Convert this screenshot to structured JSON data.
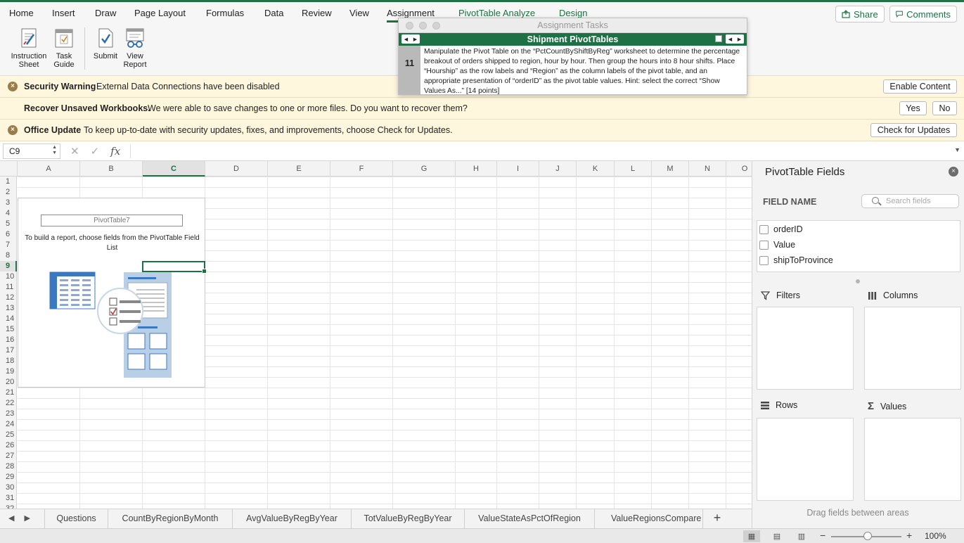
{
  "ribbon_tabs": [
    "Home",
    "Insert",
    "Draw",
    "Page Layout",
    "Formulas",
    "Data",
    "Review",
    "View",
    "Assignment",
    "PivotTable Analyze",
    "Design"
  ],
  "active_tab": "Assignment",
  "share_label": "Share",
  "comments_label": "Comments",
  "ribbon_buttons": {
    "instruction_sheet": "Instruction Sheet",
    "task_guide": "Task Guide",
    "submit": "Submit",
    "view_report": "View Report"
  },
  "security_bar": {
    "title": "Security Warning",
    "message": "External Data Connections have been disabled",
    "button": "Enable Content"
  },
  "recover_bar": {
    "title": "Recover Unsaved Workbooks.",
    "message": "We were able to save changes to one or more files. Do you want to recover them?",
    "yes": "Yes",
    "no": "No"
  },
  "update_bar": {
    "title": "Office Update",
    "message": "To keep up-to-date with security updates, fixes, and improvements, choose Check for Updates.",
    "button": "Check for Updates"
  },
  "formula_bar": {
    "name_box": "C9",
    "fx": "fx",
    "formula": ""
  },
  "columns": [
    "A",
    "B",
    "C",
    "D",
    "E",
    "F",
    "G",
    "H",
    "I",
    "J",
    "K",
    "L",
    "M",
    "N",
    "O"
  ],
  "selected_column": "C",
  "rows": [
    "1",
    "2",
    "3",
    "4",
    "5",
    "6",
    "7",
    "8",
    "9",
    "10",
    "11",
    "12",
    "13",
    "14",
    "15",
    "16",
    "17",
    "18",
    "19",
    "20",
    "21",
    "22",
    "23",
    "24",
    "25",
    "26",
    "27",
    "28",
    "29",
    "30",
    "31",
    "32"
  ],
  "selected_row": "9",
  "pivot_placeholder": {
    "name": "PivotTable7",
    "message": "To build a report, choose fields from the PivotTable Field List"
  },
  "sheet_tabs": [
    "Questions",
    "CountByRegionByMonth",
    "AvgValueByRegByYear",
    "TotValueByRegByYear",
    "ValueStateAsPctOfRegion",
    "ValueRegionsCompare"
  ],
  "status_bar": {
    "zoom": "100%"
  },
  "pivot_fields": {
    "title": "PivotTable Fields",
    "field_name_label": "FIELD NAME",
    "search_placeholder": "Search fields",
    "fields": [
      "orderID",
      "Value",
      "shipToProvince"
    ],
    "areas": {
      "filters": "Filters",
      "columns": "Columns",
      "rows": "Rows",
      "values": "Values"
    },
    "drag_hint": "Drag fields between areas"
  },
  "task_window": {
    "window_title": "Assignment Tasks",
    "header": "Shipment PivotTables",
    "task_number": "11",
    "task_text": "Manipulate the Pivot Table on the “PctCountByShiftByReg” worksheet to determine the percentage breakout of orders shipped to region, hour by hour. Then group the hours into 8 hour shifts. Place “Hourship” as the row labels and “Region” as the column labels of the pivot table, and an appropriate presentation of “orderID” as the pivot table values. Hint: select the correct “Show Values As...” [14 points]"
  },
  "colors": {
    "excel_green": "#1e7145",
    "message_bar": "#fff7dd"
  }
}
